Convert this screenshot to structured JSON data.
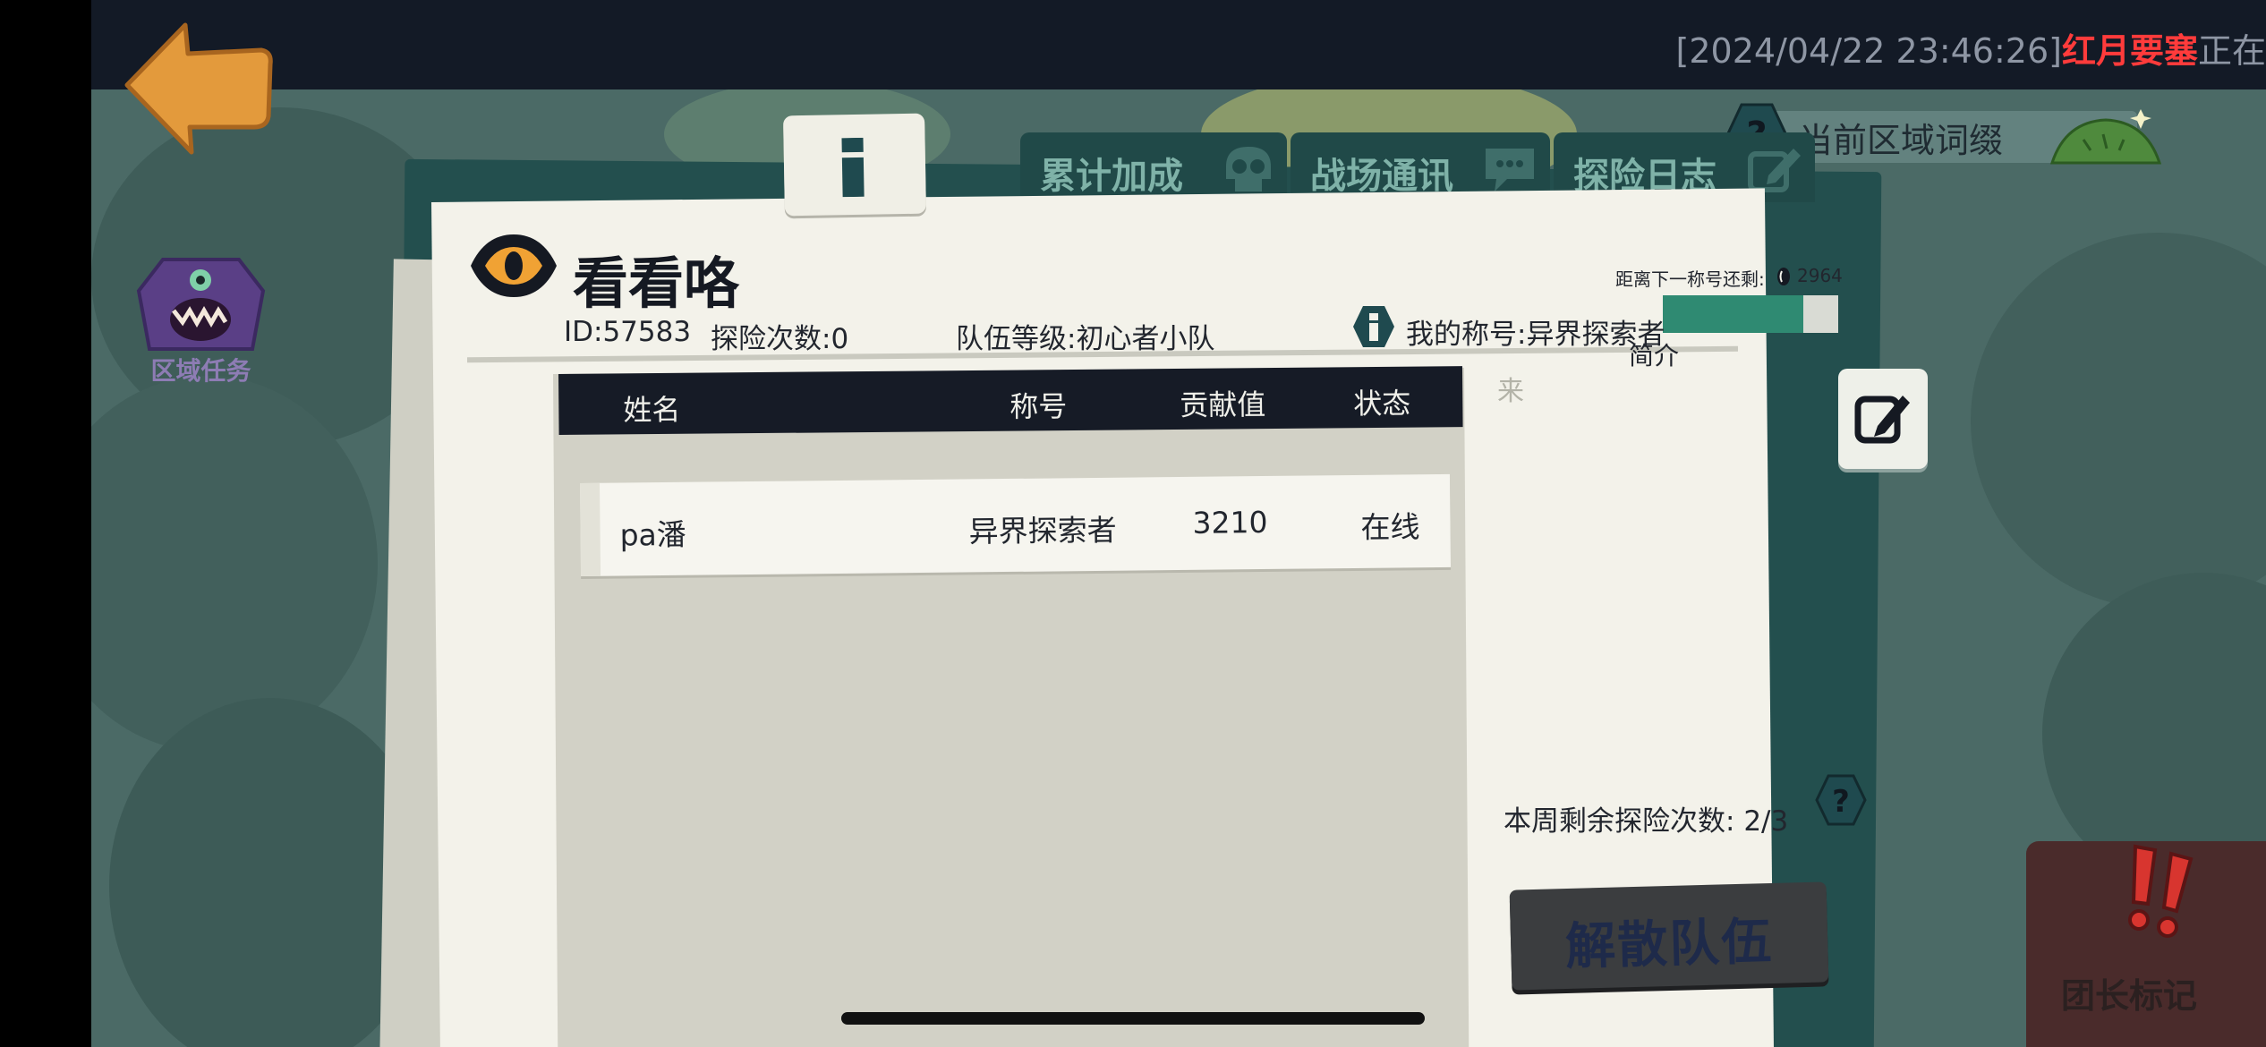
{
  "ticker": {
    "prefix": "[2024/04/22 23:46:26]",
    "highlight": "红月要塞",
    "suffix": "正在"
  },
  "sidebar": {
    "region_task_label": "区域任务"
  },
  "area_suffix": {
    "label": "当前区域词缀"
  },
  "tabs": [
    {
      "label": "累计加成",
      "icon": "skull-icon"
    },
    {
      "label": "战场通讯",
      "icon": "chat-bubble-icon"
    },
    {
      "label": "探险日志",
      "icon": "pencil-icon"
    }
  ],
  "team": {
    "name": "看看咯",
    "id_text": "ID:57583",
    "expeditions_text": "探险次数:0",
    "level_text": "队伍等级:初心者小队",
    "my_title_text": "我的称号:异界探索者",
    "next_title_label": "距离下一称号还剩:",
    "next_title_value": "2964",
    "title_progress": 0.8
  },
  "table": {
    "headers": [
      "姓名",
      "称号",
      "贡献值",
      "状态"
    ],
    "rows": [
      {
        "name": "pa潘",
        "title": "异界探索者",
        "contribution": "3210",
        "status": "在线"
      }
    ]
  },
  "intro": {
    "label": "简介",
    "text": "来"
  },
  "weekly": {
    "label": "本周剩余探险次数:",
    "value": "2/3"
  },
  "buttons": {
    "disband": "解散队伍",
    "leader_mark": "团长标记"
  },
  "colors": {
    "board": "#234f4e",
    "paper": "#f3f2ea",
    "table_header": "#161b26",
    "accent_red": "#ff3b3b",
    "eye_orange": "#f0a234"
  }
}
